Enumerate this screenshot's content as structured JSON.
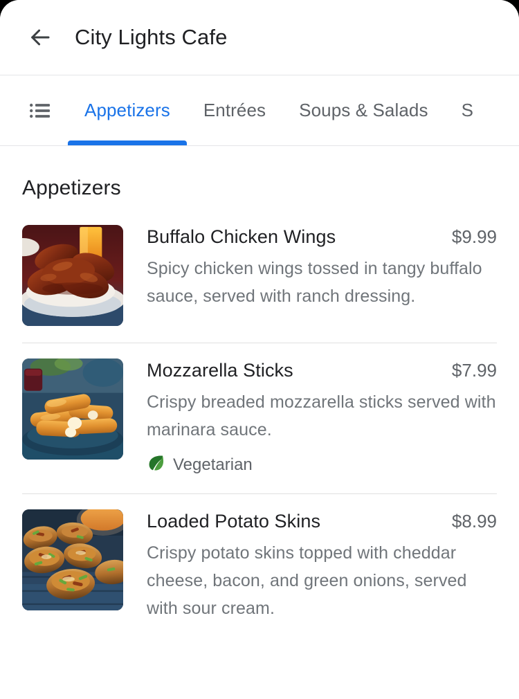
{
  "header": {
    "back_icon": "arrow-left-icon",
    "title": "City Lights Cafe"
  },
  "tab_bar": {
    "menu_icon": "list-menu-icon",
    "tabs": [
      {
        "label": "Appetizers",
        "active": true
      },
      {
        "label": "Entrées",
        "active": false
      },
      {
        "label": "Soups & Salads",
        "active": false
      },
      {
        "label": "S",
        "active": false
      }
    ],
    "active_color": "#1a73e8",
    "inactive_color": "#5f6368"
  },
  "section": {
    "title": "Appetizers"
  },
  "menu_items": [
    {
      "name": "Buffalo Chicken Wings",
      "price": "$9.99",
      "description": "Spicy chicken wings tossed in tangy buffalo sauce, served with ranch dressing.",
      "image": "buffalo-chicken-wings-photo",
      "tags": []
    },
    {
      "name": "Mozzarella Sticks",
      "price": "$7.99",
      "description": "Crispy breaded mozzarella sticks served with marinara sauce.",
      "image": "mozzarella-sticks-photo",
      "tags": [
        {
          "icon": "leaf-icon",
          "label": "Vegetarian"
        }
      ]
    },
    {
      "name": "Loaded Potato Skins",
      "price": "$8.99",
      "description": "Crispy potato skins topped with cheddar cheese, bacon, and green onions, served with sour cream.",
      "image": "loaded-potato-skins-photo",
      "tags": []
    }
  ],
  "colors": {
    "accent": "#1a73e8",
    "title_text": "#202124",
    "secondary_text": "#5f6368",
    "description_text": "#70757a",
    "divider": "#e0e0e0",
    "background": "#ffffff"
  }
}
